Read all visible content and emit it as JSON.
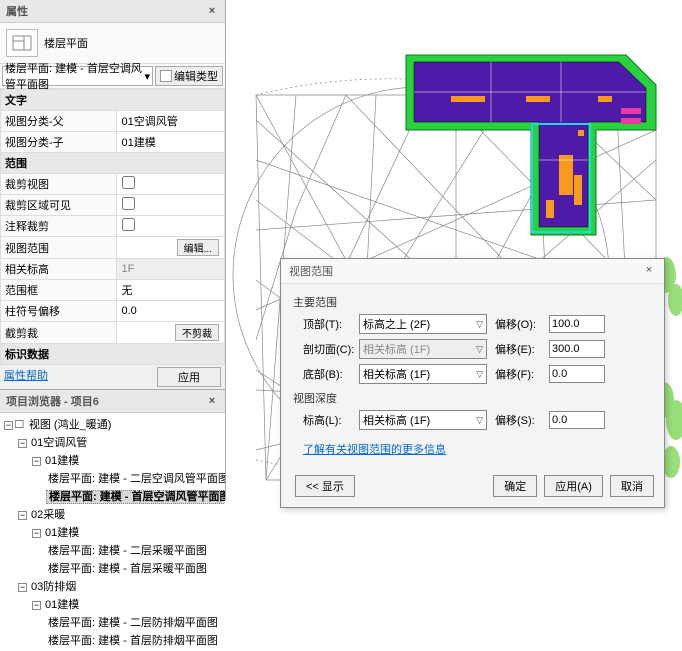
{
  "properties_panel": {
    "title": "属性",
    "type_label": "楼层平面",
    "type_selector": "楼层平面: 建模 - 首层空调风管平面图",
    "edit_type": "编辑类型",
    "groups": {
      "text": "文字",
      "extent": "范围",
      "identity": "标识数据"
    },
    "rows": {
      "view_cat_parent": {
        "label": "视图分类-父",
        "value": "01空调风管"
      },
      "view_cat_child": {
        "label": "视图分类-子",
        "value": "01建模"
      },
      "crop_view": {
        "label": "裁剪视图",
        "checked": false
      },
      "crop_region_vis": {
        "label": "裁剪区域可见",
        "checked": false
      },
      "annotation_crop": {
        "label": "注释裁剪",
        "checked": false
      },
      "view_range": {
        "label": "视图范围",
        "button": "编辑..."
      },
      "assoc_level": {
        "label": "相关标高",
        "value": "1F"
      },
      "scope_box": {
        "label": "范围框",
        "value": "无"
      },
      "column_offset": {
        "label": "柱符号偏移",
        "value": "0.0"
      },
      "depth_crop": {
        "label": "截剪裁",
        "button": "不剪裁"
      }
    },
    "help_link": "属性帮助",
    "apply": "应用"
  },
  "browser_panel": {
    "title": "项目浏览器 - 项目6",
    "tree": {
      "views": "视图 (鸿业_暖通)",
      "n1": "01空调风管",
      "n1_1": "01建模",
      "n1_1_1": "楼层平面: 建模 - 二层空调风管平面图",
      "n1_1_2": "楼层平面: 建模 - 首层空调风管平面图",
      "n2": "02采暖",
      "n2_1": "01建模",
      "n2_1_1": "楼层平面: 建模 - 二层采暖平面图",
      "n2_1_2": "楼层平面: 建模 - 首层采暖平面图",
      "n3": "03防排烟",
      "n3_1": "01建模",
      "n3_1_1": "楼层平面: 建模 - 二层防排烟平面图",
      "n3_1_2": "楼层平面: 建模 - 首层防排烟平面图"
    }
  },
  "dialog": {
    "title": "视图范围",
    "primary_range": "主要范围",
    "top": {
      "label": "顶部(T):",
      "sel": "标高之上 (2F)",
      "off_label": "偏移(O):",
      "off_val": "100.0"
    },
    "cut": {
      "label": "剖切面(C):",
      "sel": "相关标高 (1F)",
      "off_label": "偏移(E):",
      "off_val": "300.0"
    },
    "bottom": {
      "label": "底部(B):",
      "sel": "相关标高 (1F)",
      "off_label": "偏移(F):",
      "off_val": "0.0"
    },
    "view_depth": "视图深度",
    "level": {
      "label": "标高(L):",
      "sel": "相关标高 (1F)",
      "off_label": "偏移(S):",
      "off_val": "0.0"
    },
    "more_link": "了解有关视图范围的更多信息",
    "buttons": {
      "show": "<< 显示",
      "ok": "确定",
      "apply": "应用(A)",
      "cancel": "取消"
    }
  }
}
